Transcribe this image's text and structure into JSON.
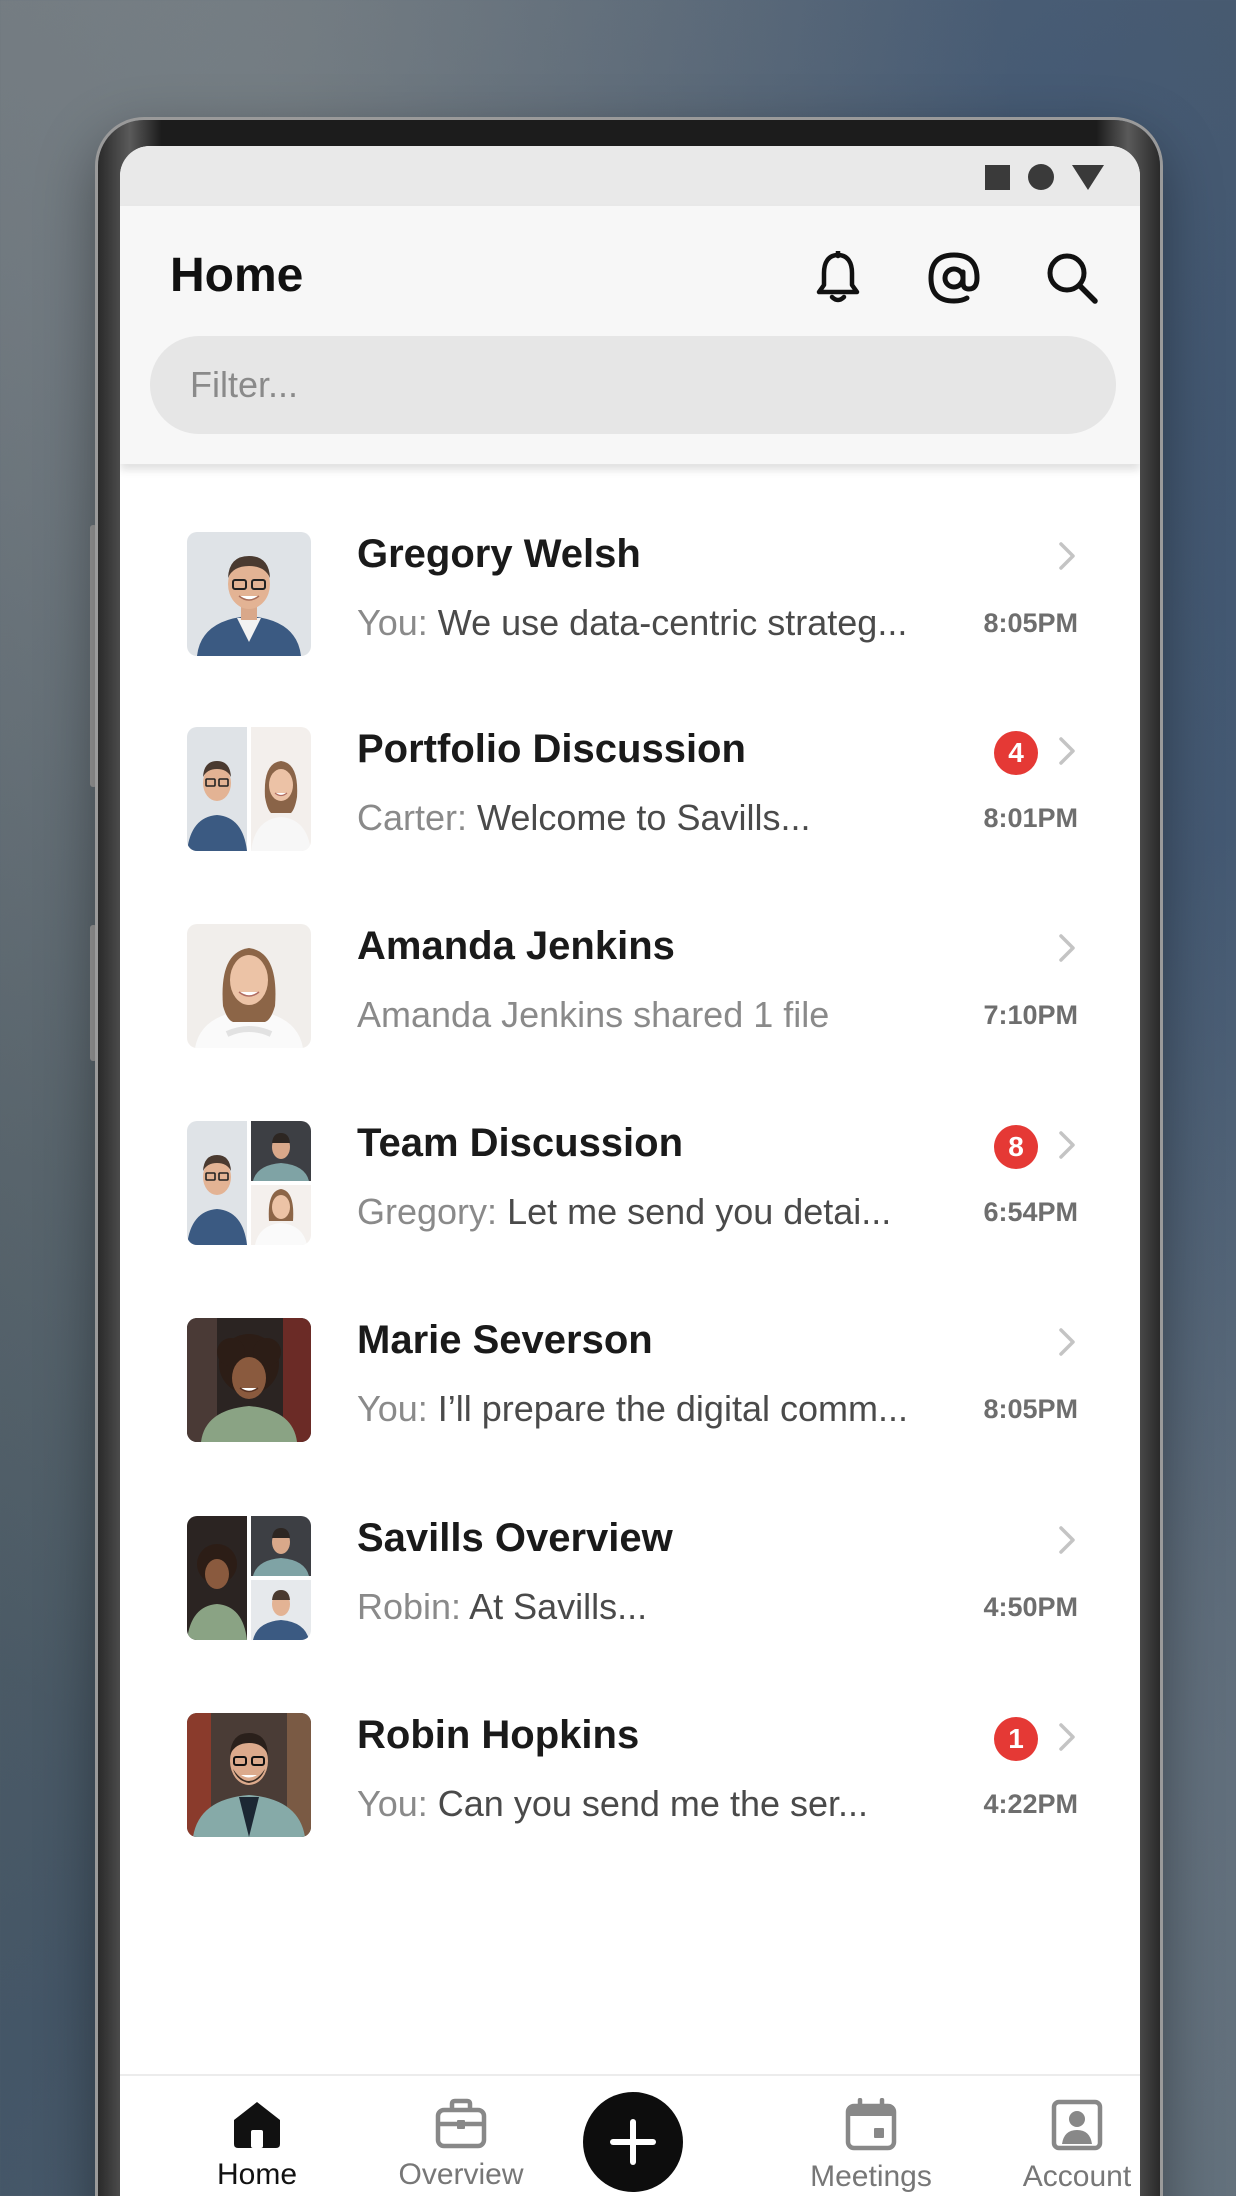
{
  "header": {
    "title": "Home",
    "filter_placeholder": "Filter...",
    "icons": [
      "bell-icon",
      "at-icon",
      "search-icon"
    ]
  },
  "status_bar": {
    "icons": [
      "square-icon",
      "circle-icon",
      "triangle-icon"
    ]
  },
  "conversations": [
    {
      "name": "Gregory Welsh",
      "who": "You:",
      "message": "We use data-centric strateg...",
      "time": "8:05PM",
      "badge": ""
    },
    {
      "name": "Portfolio Discussion",
      "who": "Carter:",
      "message": "Welcome to Savills...",
      "time": "8:01PM",
      "badge": "4"
    },
    {
      "name": "Amanda Jenkins",
      "who": "",
      "message": "Amanda Jenkins shared 1 file",
      "time": "7:10PM",
      "badge": ""
    },
    {
      "name": "Team Discussion",
      "who": "Gregory:",
      "message": "Let me send you detai...",
      "time": "6:54PM",
      "badge": "8"
    },
    {
      "name": "Marie Severson",
      "who": "You:",
      "message": "I’ll prepare the digital comm...",
      "time": "8:05PM",
      "badge": ""
    },
    {
      "name": "Savills Overview",
      "who": "Robin:",
      "message": "At Savills...",
      "time": "4:50PM",
      "badge": ""
    },
    {
      "name": "Robin Hopkins",
      "who": "You:",
      "message": "Can you send me the ser...",
      "time": "4:22PM",
      "badge": "1"
    }
  ],
  "tabbar": {
    "home": "Home",
    "overview": "Overview",
    "meetings": "Meetings",
    "account": "Account"
  },
  "colors": {
    "badge": "#e53935",
    "fab": "#0d0d0d",
    "accent": "#111111"
  }
}
